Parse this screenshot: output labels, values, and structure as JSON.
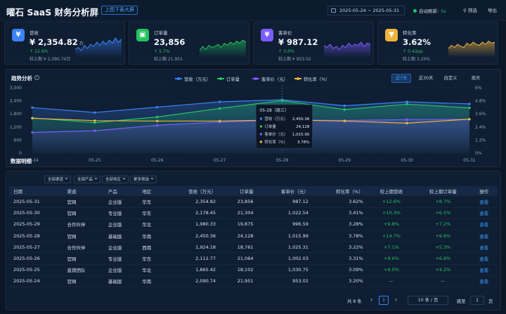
{
  "header": {
    "title": "曜石 SaaS 财务分析屏",
    "bigscreen_label": "上图下表大屏",
    "date_range": "2025-05-24 ~ 2025-05-31",
    "auto_refresh_label": "自动刷新:",
    "auto_refresh_seconds": "5s",
    "filter_label": "筛选",
    "export_label": "导出"
  },
  "kpis": [
    {
      "label": "营收",
      "icon": "¥",
      "value": "¥ 2,354.82",
      "unit": "万",
      "change": "↑ 12.6%",
      "prev": "较上期 ¥ 2,090.74万",
      "color": "#3b82f6",
      "spark": [
        0.35,
        0.45,
        0.3,
        0.55,
        0.4,
        0.6,
        0.5,
        0.7,
        0.55,
        0.75,
        0.6,
        0.8,
        0.65,
        0.9,
        0.7,
        0.85
      ]
    },
    {
      "label": "订单量",
      "icon": "▣",
      "value": "23,856",
      "unit": "",
      "change": "↑ 5.7%",
      "prev": "较上期 21,951",
      "color": "#22c55e",
      "spark": [
        0.3,
        0.5,
        0.35,
        0.55,
        0.45,
        0.5,
        0.6,
        0.45,
        0.65,
        0.55,
        0.7,
        0.6,
        0.75,
        0.65,
        0.8,
        0.7
      ]
    },
    {
      "label": "客单价",
      "icon": "¥",
      "value": "¥ 987.12",
      "unit": "",
      "change": "↑ 3.6%",
      "prev": "较上期 ¥ 953.02",
      "color": "#7c5cff",
      "spark": [
        0.55,
        0.45,
        0.6,
        0.4,
        0.5,
        0.35,
        0.55,
        0.45,
        0.65,
        0.5,
        0.6,
        0.55,
        0.7,
        0.5,
        0.65,
        0.6
      ]
    },
    {
      "label": "转化率",
      "icon": "▼",
      "value": "3.62%",
      "unit": "",
      "change": "↑ 0.42pp",
      "prev": "较上期 3.20%",
      "color": "#f0b43c",
      "spark": [
        0.4,
        0.55,
        0.45,
        0.6,
        0.5,
        0.45,
        0.65,
        0.55,
        0.7,
        0.6,
        0.55,
        0.7,
        0.6,
        0.75,
        0.65,
        0.7
      ]
    }
  ],
  "trend": {
    "title": "趋势分析",
    "info_icon": "i",
    "legend": [
      {
        "name": "营收（万元）",
        "color": "#3b82f6"
      },
      {
        "name": "订单量",
        "color": "#22c55e"
      },
      {
        "name": "客单价（元）",
        "color": "#7c5cff"
      },
      {
        "name": "转化率（%）",
        "color": "#f0b43c"
      }
    ],
    "ranges": [
      "近7天",
      "近30天",
      "自定义",
      "按天"
    ],
    "active_range": 0
  },
  "chart_data": {
    "type": "line",
    "x": [
      "05-24",
      "05-25",
      "05-26",
      "05-27",
      "05-28",
      "05-29",
      "05-30",
      "05-31"
    ],
    "y_left_ticks": [
      "3,000",
      "2,400",
      "1,800",
      "1,200",
      "600",
      "0"
    ],
    "y_right_ticks": [
      "6%",
      "4.8%",
      "3.6%",
      "2.4%",
      "1.2%",
      "0%"
    ],
    "ylim_left": [
      0,
      3000
    ],
    "ylim_right": [
      0,
      6
    ],
    "series": [
      {
        "name": "营收（万元）",
        "axis": "left",
        "color": "#3b82f6",
        "values": [
          2090.74,
          1865.42,
          2112.77,
          2354.82,
          2450.36,
          2178.45,
          2354.82,
          2260
        ]
      },
      {
        "name": "订单量",
        "axis": "left",
        "color": "#22c55e",
        "values": [
          1620,
          1400,
          1660,
          2050,
          2412.8,
          2000,
          2250,
          2080
        ]
      },
      {
        "name": "客单价（元）",
        "axis": "left",
        "color": "#7c5cff",
        "values": [
          950,
          1030,
          1280,
          1425,
          1520,
          1500,
          1540,
          1550
        ]
      },
      {
        "name": "转化率（%）",
        "axis": "right",
        "color": "#f0b43c",
        "values": [
          3.2,
          2.98,
          2.95,
          2.95,
          3.05,
          2.95,
          2.75,
          3.12
        ]
      }
    ],
    "tooltip": {
      "date": "05-28（周三）",
      "highlight_index": 4,
      "rows": [
        {
          "name": "营收（万元）",
          "value": "2,450.36"
        },
        {
          "name": "订单量",
          "value": "24,128"
        },
        {
          "name": "客单价（元）",
          "value": "1,015.90"
        },
        {
          "name": "转化率（%）",
          "value": "3.78%"
        }
      ]
    }
  },
  "table": {
    "title": "数据明细",
    "filters": [
      "全部渠道",
      "全部产品",
      "全部地区",
      "更多筛选"
    ],
    "columns": [
      "日期",
      "渠道",
      "产品",
      "地区",
      "营收（万元）",
      "订单量",
      "客单价（元）",
      "转化率（%）",
      "较上期营收",
      "较上期订单量",
      "操作"
    ],
    "rows": [
      [
        "2025-05-31",
        "官网",
        "企业版",
        "华东",
        "2,354.82",
        "23,856",
        "987.12",
        "3.62%",
        "+12.6%",
        "+8.7%",
        "查看"
      ],
      [
        "2025-05-30",
        "官网",
        "专业版",
        "华东",
        "2,178.45",
        "21,304",
        "1,022.54",
        "3.41%",
        "+10.3%",
        "+6.5%",
        "查看"
      ],
      [
        "2025-05-29",
        "合作伙伴",
        "企业版",
        "华北",
        "1,980.33",
        "19,875",
        "996.59",
        "3.28%",
        "+9.8%",
        "+7.2%",
        "查看"
      ],
      [
        "2025-05-28",
        "官网",
        "基础版",
        "华南",
        "2,450.36",
        "24,128",
        "1,015.99",
        "3.78%",
        "+14.7%",
        "+9.6%",
        "查看"
      ],
      [
        "2025-05-27",
        "合作伙伴",
        "企业版",
        "西南",
        "1,924.18",
        "18,761",
        "1,025.31",
        "3.22%",
        "+7.1%",
        "+5.3%",
        "查看"
      ],
      [
        "2025-05-26",
        "官网",
        "专业版",
        "华东",
        "2,112.77",
        "21,064",
        "1,002.03",
        "3.31%",
        "+9.6%",
        "+6.8%",
        "查看"
      ],
      [
        "2025-05-25",
        "直销团队",
        "企业版",
        "华北",
        "1,865.42",
        "18,102",
        "1,030.75",
        "3.09%",
        "+6.0%",
        "+4.2%",
        "查看"
      ],
      [
        "2025-05-24",
        "官网",
        "基础版",
        "华南",
        "2,090.74",
        "21,951",
        "953.02",
        "3.20%",
        "—",
        "—",
        "查看"
      ]
    ]
  },
  "pagination": {
    "total": "共 8 条",
    "prev": "‹",
    "current": "1",
    "next": "›",
    "page_size": "10 条 / 页",
    "goto_label": "跳至",
    "goto_value": "1",
    "page_suffix": "页"
  }
}
